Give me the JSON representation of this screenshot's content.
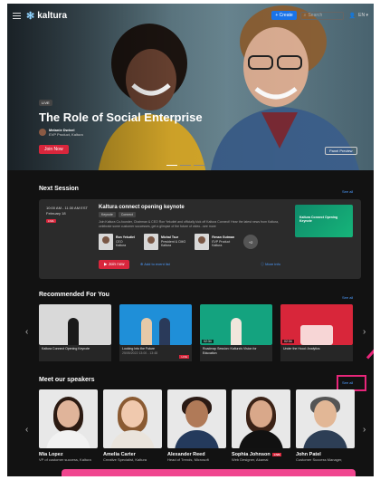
{
  "header": {
    "logo_text": "kaltura",
    "create_label": "+ Create",
    "search_placeholder": "Search",
    "lang_label": "EN"
  },
  "hero": {
    "badge": "LIVE",
    "title": "The Role of Social Enterprise",
    "presenter_name": "Melanie Dwivel",
    "presenter_role": "EVP Product, Kaltura",
    "join_label": "Join Now",
    "preview_label": "Panel Preview"
  },
  "next_session": {
    "heading": "Next Session",
    "see_all": "See all",
    "time": "10:00 AM - 11:30 AM EST",
    "date": "February 18",
    "live": "LIVE",
    "title": "Kaltura connect opening keynote",
    "tags": [
      "Keynote",
      "Connect"
    ],
    "description": "Join Kaltura Co-founder, Chairman & CEO Ron Yekutiel and officially kick off Kaltura Connect! Hear the latest news from Kaltura, celebrate some customer successes, get a glimpse of the future of video...see more",
    "speakers": [
      {
        "name": "Ron Yekutiel",
        "role": "CEO",
        "org": "Kaltura"
      },
      {
        "name": "Michal Tsur",
        "role": "President & CMO",
        "org": "Kaltura"
      },
      {
        "name": "Renan Gutman",
        "role": "EVP Product",
        "org": "Kaltura"
      }
    ],
    "more_count": "+2",
    "thumb_label": "Kaltura Connect Opening Keynote",
    "join_label": "Join now",
    "calendar_label": "Add to event list",
    "more_info_label": "More info"
  },
  "recommended": {
    "heading": "Recommended For You",
    "see_all": "See all",
    "items": [
      {
        "title": "Kaltura Connect Opening Keynote",
        "date": "",
        "duration": "",
        "live": ""
      },
      {
        "title": "Looking Into the Future",
        "date": "25/05/2022 13:00 - 13:48",
        "duration": "",
        "live": "LIVE"
      },
      {
        "title": "Roadmap Session: Kaltura's Vision for Education",
        "date": "",
        "duration": "02:34",
        "live": ""
      },
      {
        "title": "Under the Hood: Analytics",
        "date": "",
        "duration": "02:34",
        "live": ""
      }
    ]
  },
  "speakers": {
    "heading": "Meet our speakers",
    "see_all": "See all",
    "items": [
      {
        "name": "Mia Lopez",
        "role": "VP of customer success, Kaltura",
        "live": ""
      },
      {
        "name": "Amelia Carter",
        "role": "Creative Specialist, Kaltura",
        "live": ""
      },
      {
        "name": "Alexander Reed",
        "role": "Head of Trends, Microsoft",
        "live": ""
      },
      {
        "name": "Sophia Johnson",
        "role": "Web Designer, Akamai",
        "live": "LIVE"
      },
      {
        "name": "John Patel",
        "role": "Customer Success Manager,",
        "live": ""
      }
    ]
  },
  "colors": {
    "accent": "#d9263c",
    "link": "#4d9cff",
    "highlight": "#e8267a",
    "background": "#121212"
  }
}
